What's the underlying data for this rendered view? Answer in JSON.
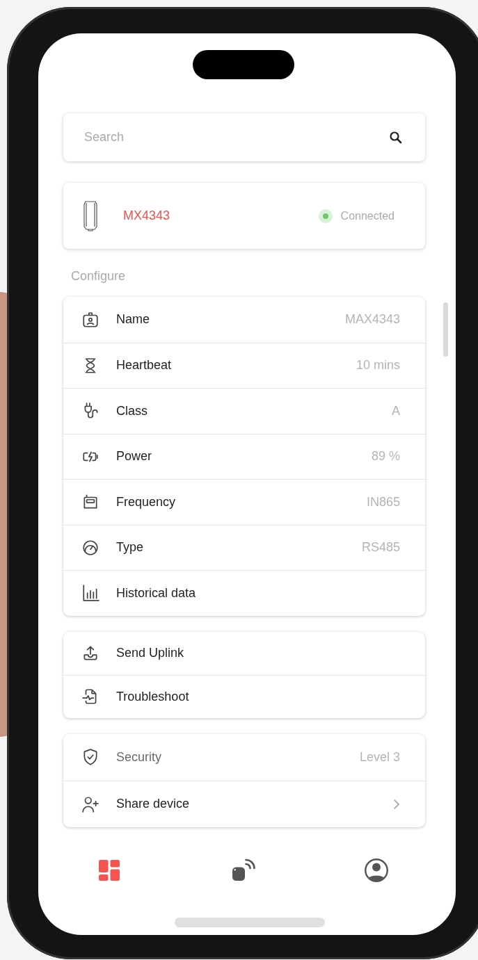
{
  "search": {
    "placeholder": "Search"
  },
  "device": {
    "name": "MX4343",
    "status": "Connected",
    "connected": true
  },
  "configure": {
    "heading": "Configure",
    "rows": [
      {
        "label": "Name",
        "value": "MAX4343"
      },
      {
        "label": "Heartbeat",
        "value": "10 mins"
      },
      {
        "label": "Class",
        "value": "A"
      },
      {
        "label": "Power",
        "value": "89 %"
      },
      {
        "label": "Frequency",
        "value": "IN865"
      },
      {
        "label": "Type",
        "value": "RS485"
      },
      {
        "label": "Historical data"
      }
    ]
  },
  "actions": [
    {
      "label": "Send Uplink"
    },
    {
      "label": "Troubleshoot"
    }
  ],
  "access": [
    {
      "kind": "value",
      "label": "Security",
      "value": "Level 3",
      "disabled": true
    },
    {
      "kind": "link",
      "label": "Share device",
      "disabled": false
    }
  ],
  "nav": [
    {
      "selected": true
    },
    {
      "selected": false
    },
    {
      "selected": false
    }
  ]
}
